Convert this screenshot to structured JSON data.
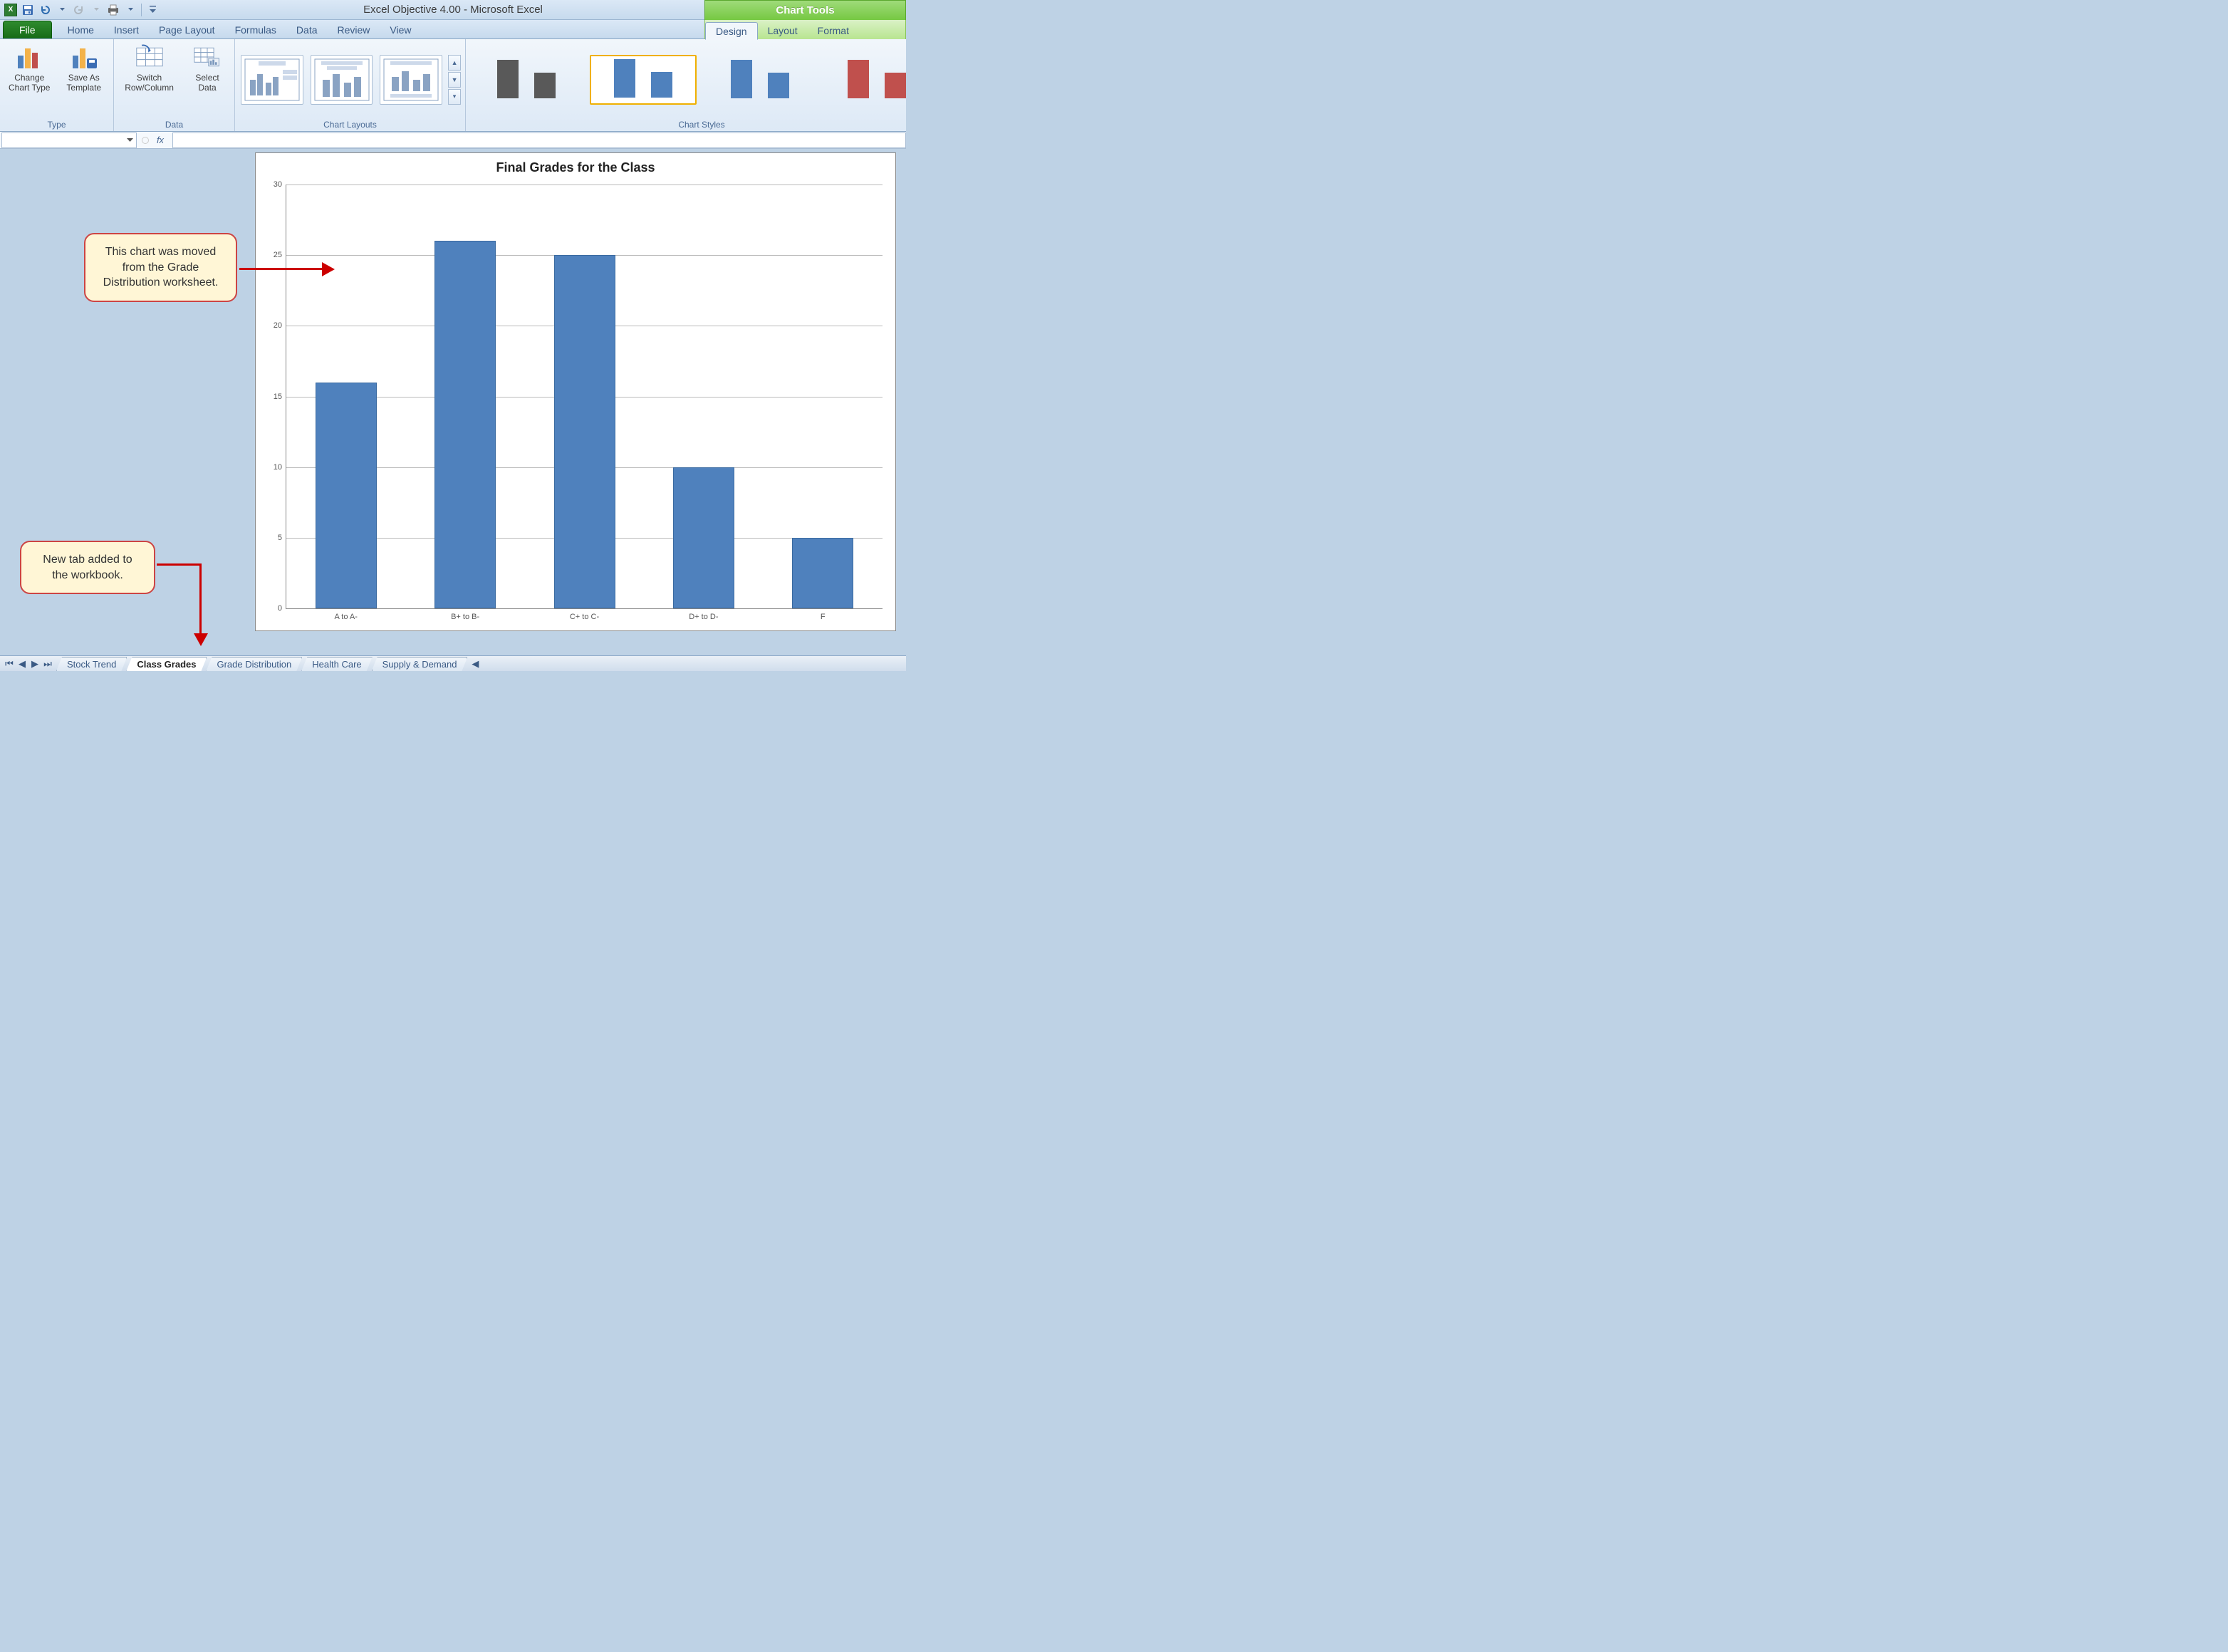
{
  "titlebar": {
    "title": "Excel Objective 4.00 - Microsoft Excel",
    "context_title": "Chart Tools"
  },
  "tabs": {
    "file": "File",
    "items": [
      "Home",
      "Insert",
      "Page Layout",
      "Formulas",
      "Data",
      "Review",
      "View"
    ],
    "context": [
      "Design",
      "Layout",
      "Format"
    ],
    "context_active": "Design"
  },
  "ribbon": {
    "type": {
      "label": "Type",
      "change": "Change Chart Type",
      "save": "Save As Template"
    },
    "data": {
      "label": "Data",
      "switch": "Switch Row/Column",
      "select": "Select Data"
    },
    "layouts": {
      "label": "Chart Layouts"
    },
    "styles": {
      "label": "Chart Styles",
      "items": [
        {
          "colors": [
            "#595959",
            "#595959"
          ],
          "selected": false
        },
        {
          "colors": [
            "#4f81bd",
            "#4f81bd"
          ],
          "selected": true
        },
        {
          "colors": [
            "#4f81bd",
            "#4f81bd"
          ],
          "selected": false
        },
        {
          "colors": [
            "#c0504d",
            "#c0504d"
          ],
          "selected": false
        }
      ]
    }
  },
  "formulabar": {
    "fx": "fx",
    "name": ""
  },
  "callouts": {
    "c1": "This chart was moved from the Grade Distribution worksheet.",
    "c2": "New tab added to the workbook."
  },
  "sheet_tabs": {
    "items": [
      "Stock Trend",
      "Class Grades",
      "Grade Distribution",
      "Health Care",
      "Supply & Demand"
    ],
    "active": "Class Grades"
  },
  "chart_data": {
    "type": "bar",
    "title": "Final Grades for the Class",
    "xlabel": "",
    "ylabel": "",
    "ylim": [
      0,
      30
    ],
    "yticks": [
      0,
      5,
      10,
      15,
      20,
      25,
      30
    ],
    "categories": [
      "A to A-",
      "B+ to B-",
      "C+ to C-",
      "D+ to D-",
      "F"
    ],
    "values": [
      16,
      26,
      25,
      10,
      5
    ]
  }
}
